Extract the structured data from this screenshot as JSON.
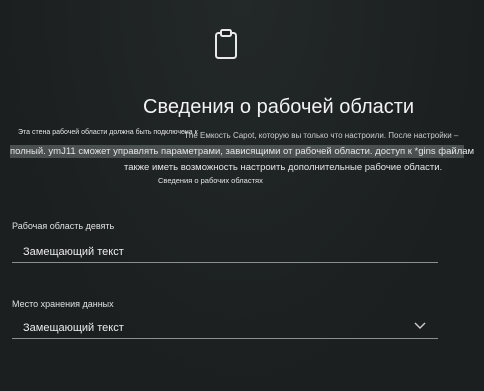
{
  "dialog": {
    "icon": "clipboard-icon",
    "title": "Сведения о рабочей области",
    "description_small": "Эта стена рабочей области должна быть подключена к",
    "description_line1": "The Емкость Capot, которую вы только что настроили. После настройки –",
    "description_line2": "полный. ymJ11 сможет управлять параметрами, зависящими от рабочей области. доступ к *gins файлам",
    "description_line3": "также иметь возможность настроить дополнительные рабочие области.",
    "link_text": "Сведения о рабочих областях"
  },
  "form": {
    "workspace_name": {
      "label": "Рабочая область девять",
      "value": "Замещающий текст"
    },
    "storage_location": {
      "label": "Место хранения данных",
      "value": "Замещающий текст",
      "icon": "chevron-down-icon"
    }
  },
  "colors": {
    "background": "#1b1f1f",
    "text": "#e8e8e8",
    "highlight": "#4a4f4f",
    "underline": "#8a8f8f"
  }
}
